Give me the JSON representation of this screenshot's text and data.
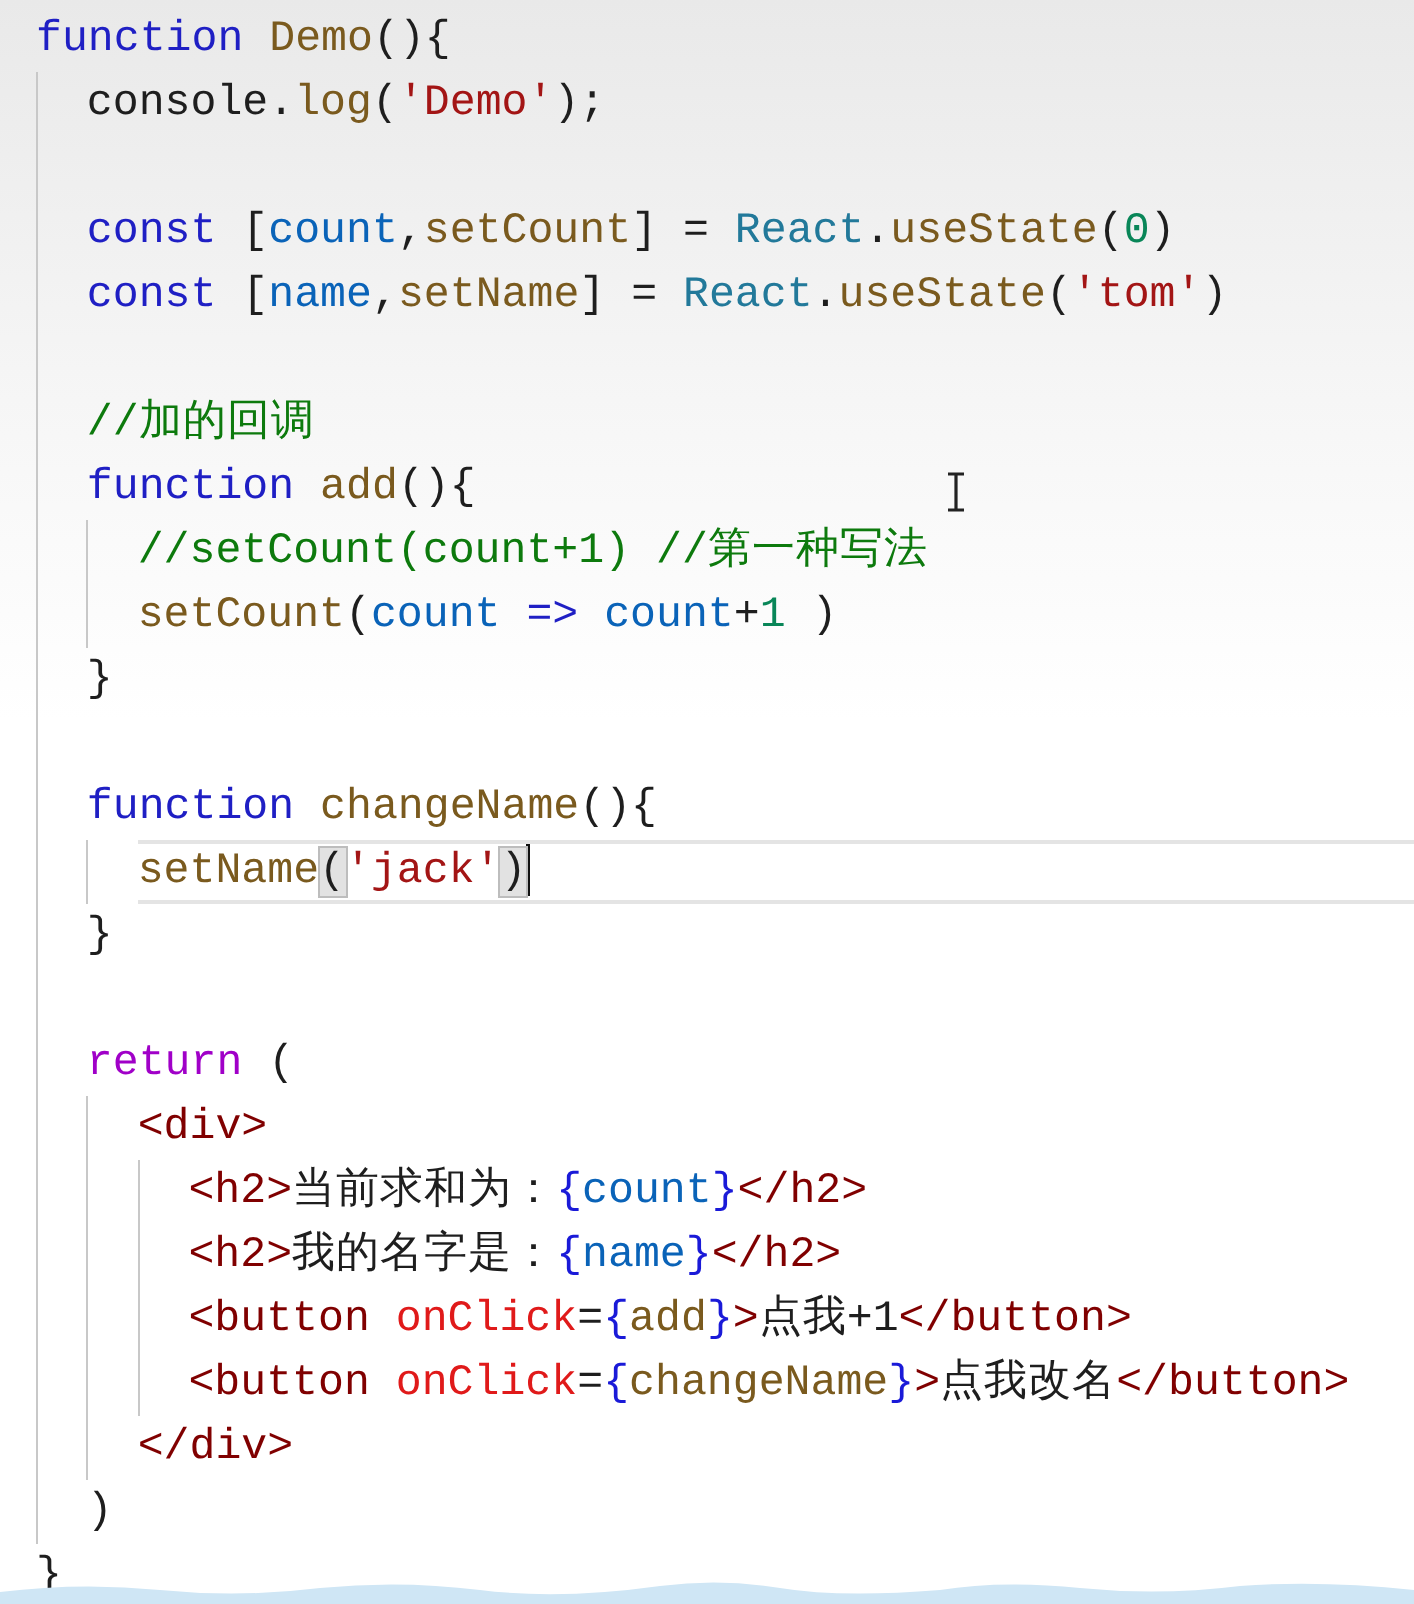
{
  "editor": {
    "lines": [
      {
        "tokens": [
          {
            "t": "function ",
            "kind": "keyword"
          },
          {
            "t": "Demo",
            "kind": "func"
          },
          {
            "t": "(){",
            "kind": "plain"
          }
        ],
        "children": [
          {
            "tokens": [
              {
                "t": "console.",
                "kind": "plain"
              },
              {
                "t": "log",
                "kind": "func"
              },
              {
                "t": "(",
                "kind": "plain"
              },
              {
                "t": "'Demo'",
                "kind": "string"
              },
              {
                "t": ");",
                "kind": "plain"
              }
            ]
          },
          {
            "kind": "blank"
          },
          {
            "tokens": [
              {
                "t": "const",
                "kind": "keyword"
              },
              {
                "t": " [",
                "kind": "plain"
              },
              {
                "t": "count",
                "kind": "var"
              },
              {
                "t": ",",
                "kind": "plain"
              },
              {
                "t": "setCount",
                "kind": "func"
              },
              {
                "t": "] = ",
                "kind": "plain"
              },
              {
                "t": "React",
                "kind": "type"
              },
              {
                "t": ".",
                "kind": "plain"
              },
              {
                "t": "useState",
                "kind": "func"
              },
              {
                "t": "(",
                "kind": "plain"
              },
              {
                "t": "0",
                "kind": "number"
              },
              {
                "t": ")",
                "kind": "plain"
              }
            ]
          },
          {
            "tokens": [
              {
                "t": "const",
                "kind": "keyword"
              },
              {
                "t": " [",
                "kind": "plain"
              },
              {
                "t": "name",
                "kind": "var"
              },
              {
                "t": ",",
                "kind": "plain"
              },
              {
                "t": "setName",
                "kind": "func"
              },
              {
                "t": "] = ",
                "kind": "plain"
              },
              {
                "t": "React",
                "kind": "type"
              },
              {
                "t": ".",
                "kind": "plain"
              },
              {
                "t": "useState",
                "kind": "func"
              },
              {
                "t": "(",
                "kind": "plain"
              },
              {
                "t": "'tom'",
                "kind": "string"
              },
              {
                "t": ")",
                "kind": "plain"
              }
            ]
          },
          {
            "kind": "blank"
          },
          {
            "tokens": [
              {
                "t": "//加的回调",
                "kind": "comment"
              }
            ]
          },
          {
            "tokens": [
              {
                "t": "function ",
                "kind": "keyword"
              },
              {
                "t": "add",
                "kind": "func"
              },
              {
                "t": "(){",
                "kind": "plain"
              }
            ],
            "children": [
              {
                "tokens": [
                  {
                    "t": "//setCount(count+1) //第一种写法",
                    "kind": "comment"
                  }
                ]
              },
              {
                "tokens": [
                  {
                    "t": "setCount",
                    "kind": "func"
                  },
                  {
                    "t": "(",
                    "kind": "plain"
                  },
                  {
                    "t": "count",
                    "kind": "var"
                  },
                  {
                    "t": " => ",
                    "kind": "keyword"
                  },
                  {
                    "t": "count",
                    "kind": "var"
                  },
                  {
                    "t": "+",
                    "kind": "plain"
                  },
                  {
                    "t": "1",
                    "kind": "number"
                  },
                  {
                    "t": " )",
                    "kind": "plain"
                  }
                ]
              }
            ]
          },
          {
            "tokens": [
              {
                "t": "}",
                "kind": "plain"
              }
            ]
          },
          {
            "kind": "blank"
          },
          {
            "tokens": [
              {
                "t": "function ",
                "kind": "keyword"
              },
              {
                "t": "changeName",
                "kind": "func"
              },
              {
                "t": "(){",
                "kind": "plain"
              }
            ],
            "children": [
              {
                "current": true,
                "tokens": [
                  {
                    "t": "setName",
                    "kind": "func"
                  },
                  {
                    "t": "(",
                    "kind": "plain",
                    "matched": true
                  },
                  {
                    "t": "'jack'",
                    "kind": "string"
                  },
                  {
                    "t": ")",
                    "kind": "plain",
                    "matched": true
                  }
                ]
              }
            ]
          },
          {
            "tokens": [
              {
                "t": "}",
                "kind": "plain"
              }
            ]
          },
          {
            "kind": "blank"
          },
          {
            "tokens": [
              {
                "t": "return",
                "kind": "control"
              },
              {
                "t": " (",
                "kind": "plain"
              }
            ],
            "children": [
              {
                "tokens": [
                  {
                    "t": "<div>",
                    "kind": "tag"
                  }
                ],
                "children": [
                  {
                    "tokens": [
                      {
                        "t": "<h2>",
                        "kind": "tag"
                      },
                      {
                        "t": "当前求和为：",
                        "kind": "plain"
                      },
                      {
                        "t": "{",
                        "kind": "brace"
                      },
                      {
                        "t": "count",
                        "kind": "var"
                      },
                      {
                        "t": "}",
                        "kind": "brace"
                      },
                      {
                        "t": "</h2>",
                        "kind": "tag"
                      }
                    ]
                  },
                  {
                    "tokens": [
                      {
                        "t": "<h2>",
                        "kind": "tag"
                      },
                      {
                        "t": "我的名字是：",
                        "kind": "plain"
                      },
                      {
                        "t": "{",
                        "kind": "brace"
                      },
                      {
                        "t": "name",
                        "kind": "var"
                      },
                      {
                        "t": "}",
                        "kind": "brace"
                      },
                      {
                        "t": "</h2>",
                        "kind": "tag"
                      }
                    ]
                  },
                  {
                    "tokens": [
                      {
                        "t": "<button ",
                        "kind": "tag"
                      },
                      {
                        "t": "onClick",
                        "kind": "attr"
                      },
                      {
                        "t": "=",
                        "kind": "plain"
                      },
                      {
                        "t": "{",
                        "kind": "brace"
                      },
                      {
                        "t": "add",
                        "kind": "func"
                      },
                      {
                        "t": "}",
                        "kind": "brace"
                      },
                      {
                        "t": ">",
                        "kind": "tag"
                      },
                      {
                        "t": "点我+1",
                        "kind": "plain"
                      },
                      {
                        "t": "</button>",
                        "kind": "tag"
                      }
                    ]
                  },
                  {
                    "tokens": [
                      {
                        "t": "<button ",
                        "kind": "tag"
                      },
                      {
                        "t": "onClick",
                        "kind": "attr"
                      },
                      {
                        "t": "=",
                        "kind": "plain"
                      },
                      {
                        "t": "{",
                        "kind": "brace"
                      },
                      {
                        "t": "changeName",
                        "kind": "func"
                      },
                      {
                        "t": "}",
                        "kind": "brace"
                      },
                      {
                        "t": ">",
                        "kind": "tag"
                      },
                      {
                        "t": "点我改名",
                        "kind": "plain"
                      },
                      {
                        "t": "</button>",
                        "kind": "tag"
                      }
                    ]
                  }
                ]
              },
              {
                "tokens": [
                  {
                    "t": "</div>",
                    "kind": "tag"
                  }
                ]
              }
            ]
          },
          {
            "tokens": [
              {
                "t": ")",
                "kind": "plain"
              }
            ]
          }
        ]
      },
      {
        "tokens": [
          {
            "t": "}",
            "kind": "plain"
          }
        ]
      }
    ]
  }
}
